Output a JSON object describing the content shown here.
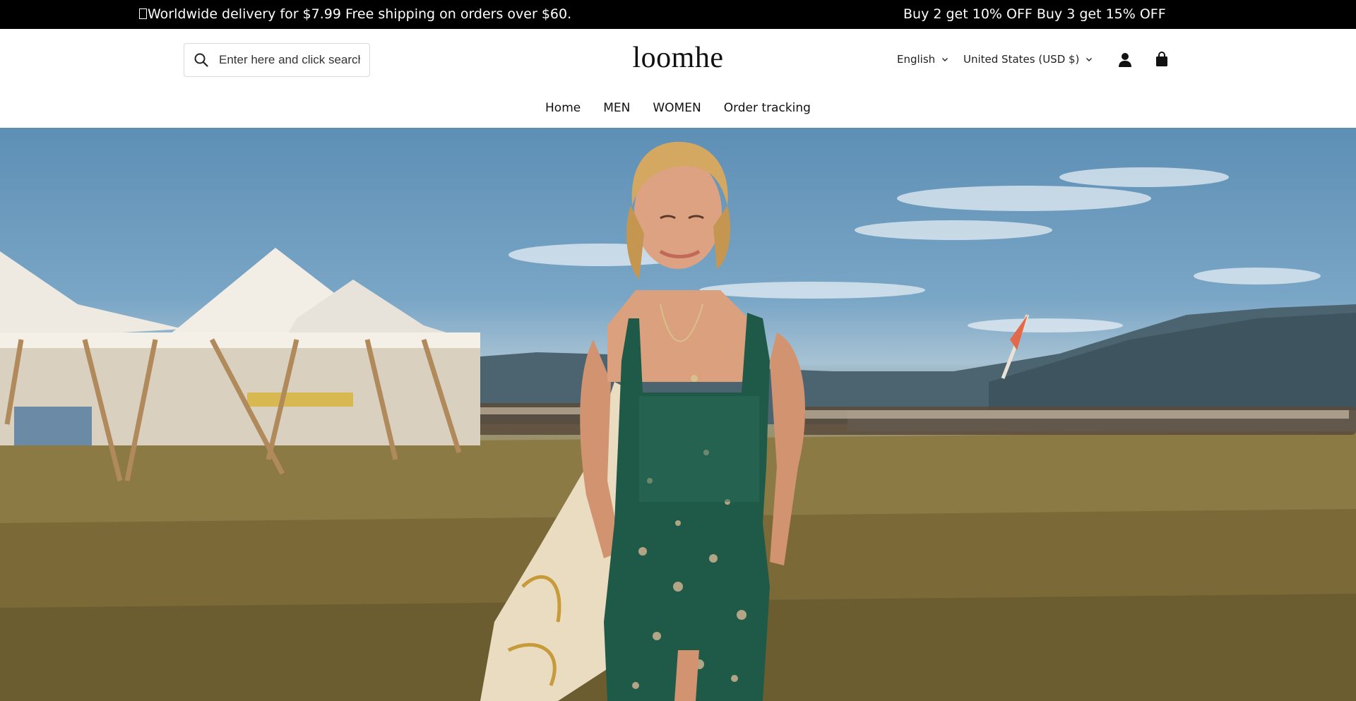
{
  "announcement": {
    "left_text": "Worldwide delivery for $7.99 Free shipping on orders over $60.",
    "right_text": "Buy 2 get 10% OFF  Buy 3 get 15% OFF"
  },
  "header": {
    "search": {
      "placeholder": "Enter here and click search",
      "icon": "search-icon"
    },
    "logo": "loomhe",
    "language": "English",
    "country": "United States (USD $)",
    "account_icon": "account-icon",
    "cart_icon": "cart-icon"
  },
  "nav": {
    "items": [
      {
        "label": "Home"
      },
      {
        "label": "MEN"
      },
      {
        "label": "WOMEN"
      },
      {
        "label": "Order tracking"
      }
    ]
  },
  "hero": {
    "image": "woman in green floral dress walking in field with tents"
  },
  "colors": {
    "announcement_bg": "#000000",
    "announcement_text": "#ffffff",
    "dress_green": "#1f5a48"
  }
}
